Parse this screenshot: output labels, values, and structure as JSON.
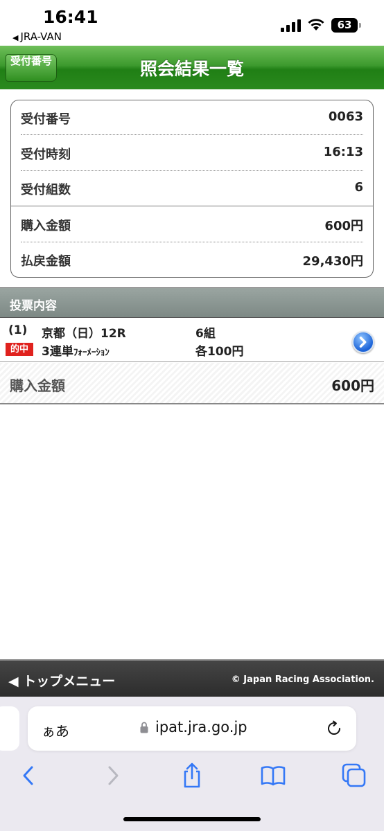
{
  "status": {
    "time": "16:41",
    "back_app": "JRA-VAN",
    "battery": "63"
  },
  "header": {
    "back_label": "受付番号",
    "title": "照会結果一覧"
  },
  "summary": [
    {
      "label": "受付番号",
      "value": "0063"
    },
    {
      "label": "受付時刻",
      "value": "16:13"
    },
    {
      "label": "受付組数",
      "value": "6"
    },
    {
      "label": "購入金額",
      "value": "600円"
    },
    {
      "label": "払戻金額",
      "value": "29,430円"
    }
  ],
  "section": {
    "title": "投票内容"
  },
  "vote": {
    "number": "(1)",
    "race": "京都（日）12R",
    "sets": "6組",
    "hit_badge": "的中",
    "bet_type_main": "3連単",
    "bet_type_sub": "ﾌｫｰﾒｰｼｮﾝ",
    "amount_each": "各100円"
  },
  "total": {
    "label": "購入金額",
    "value": "600円"
  },
  "footer": {
    "menu": "トップメニュー",
    "copyright": "© Japan Racing Association."
  },
  "browser": {
    "aa": "ぁあ",
    "url": "ipat.jra.go.jp"
  },
  "colors": {
    "header_green": "#2a8a1e",
    "hit_red": "#e0221e",
    "section_gray": "#8a9591",
    "ios_blue": "#3478f6"
  }
}
